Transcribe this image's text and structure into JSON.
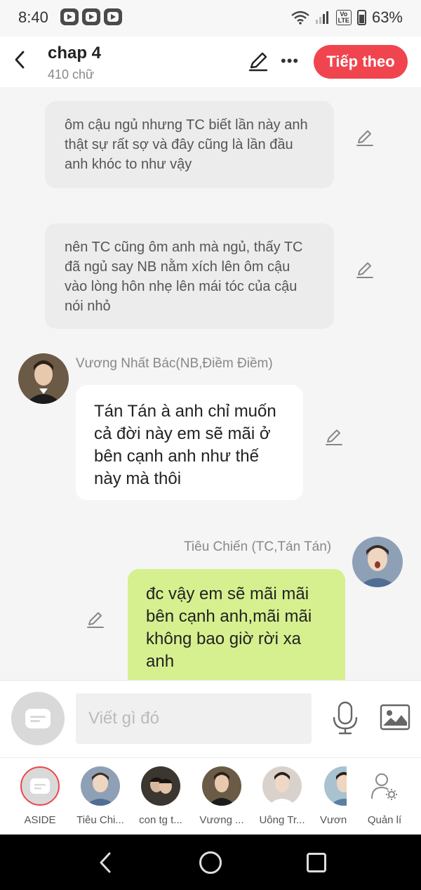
{
  "status_bar": {
    "time": "8:40",
    "battery_percent": "63%",
    "network_label": "Vo LTE"
  },
  "header": {
    "title": "chap 4",
    "word_count": "410 chữ",
    "next_button": "Tiếp theo"
  },
  "messages": {
    "narration_1": "ôm cậu ngủ nhưng TC biết lần này anh thật sự rất sợ và đây cũng là lần đầu anh khóc to như vậy",
    "narration_2": "nên TC cũng ôm anh mà ngủ, thấy TC đã ngủ say NB nằm xích lên ôm cậu vào lòng hôn nhẹ lên mái tóc của cậu nói nhỏ",
    "left_sender": "Vương Nhất Bác(NB,Điềm Điềm)",
    "left_text": "Tán Tán à anh chỉ muốn cả đời này em sẽ mãi ở bên cạnh anh như thế này mà thôi",
    "right_sender": "Tiêu Chiến (TC,Tán Tán)",
    "right_text": "đc vậy em sẽ mãi mãi bên cạnh anh,mãi mãi không bao giờ rời xa anh"
  },
  "input": {
    "placeholder": "Viết gì đó"
  },
  "characters": [
    {
      "name": "ASIDE"
    },
    {
      "name": "Tiêu Chi..."
    },
    {
      "name": "con tg t..."
    },
    {
      "name": "Vương ..."
    },
    {
      "name": "Uông Tr..."
    },
    {
      "name": "Vương"
    },
    {
      "name": "Quản lí"
    }
  ],
  "colors": {
    "accent": "#f0454f",
    "right_bubble": "#d6f08f"
  }
}
